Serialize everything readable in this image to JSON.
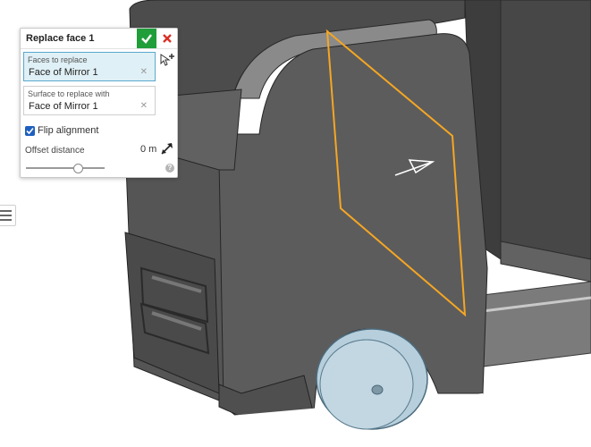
{
  "dialog": {
    "title": "Replace face 1",
    "accept_icon": "checkmark-icon",
    "cancel_icon": "close-icon",
    "faces_field": {
      "label": "Faces to replace",
      "value": "Face of Mirror 1"
    },
    "surface_field": {
      "label": "Surface to replace with",
      "value": "Face of Mirror 1"
    },
    "flip_alignment": {
      "label": "Flip alignment",
      "checked": true
    },
    "offset": {
      "label": "Offset distance",
      "value": "0 m",
      "slider_fraction": 0.66
    }
  },
  "colors": {
    "accent_green": "#1f9e3a",
    "cancel_red": "#d93025",
    "selection_orange": "#f5a623",
    "active_field_blue": "#dff0f6",
    "wheel_blue": "#b7cfdc",
    "body_gray": "#5a5a5a"
  }
}
